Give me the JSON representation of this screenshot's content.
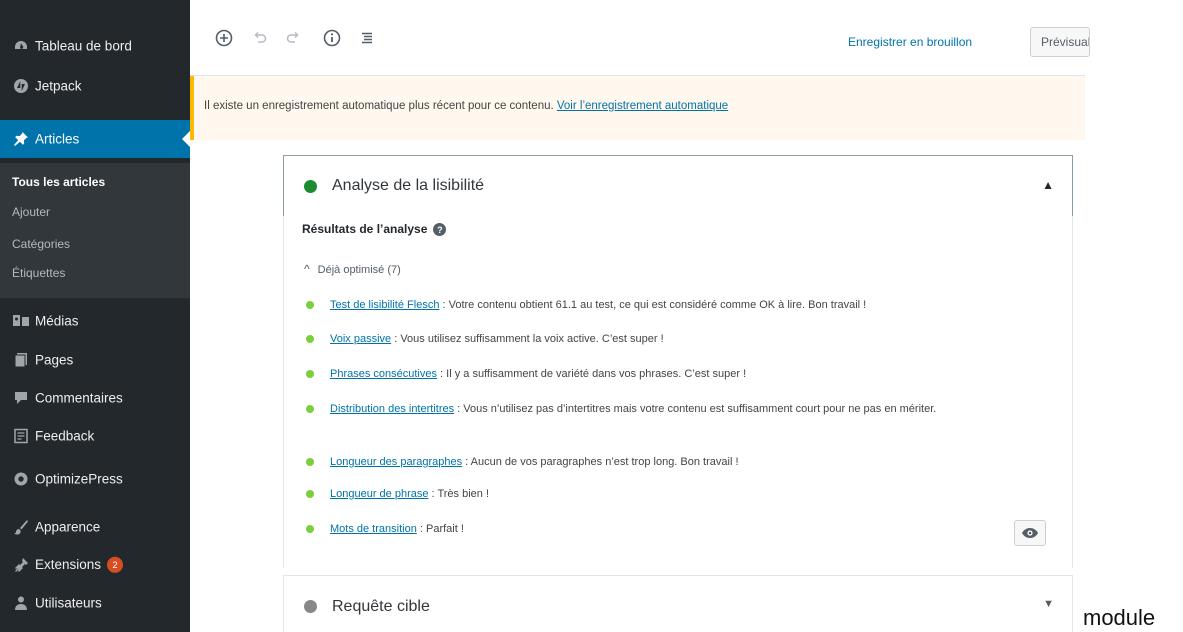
{
  "sidebar": {
    "items": [
      {
        "label": "Tableau de bord",
        "icon": "dashboard-icon"
      },
      {
        "label": "Jetpack",
        "icon": "jetpack-icon"
      },
      {
        "label": "Articles",
        "icon": "pin-icon",
        "current": true
      },
      {
        "label": "Médias",
        "icon": "media-icon"
      },
      {
        "label": "Pages",
        "icon": "pages-icon"
      },
      {
        "label": "Commentaires",
        "icon": "comments-icon"
      },
      {
        "label": "Feedback",
        "icon": "feedback-icon"
      },
      {
        "label": "OptimizePress",
        "icon": "optimizepress-icon"
      },
      {
        "label": "Apparence",
        "icon": "brush-icon"
      },
      {
        "label": "Extensions",
        "icon": "plugin-icon",
        "badge": "2"
      },
      {
        "label": "Utilisateurs",
        "icon": "users-icon"
      }
    ],
    "submenu": [
      "Tous les articles",
      "Ajouter",
      "Catégories",
      "Étiquettes"
    ]
  },
  "toolbar": {
    "icons": [
      "add-block-icon",
      "undo-icon",
      "redo-icon",
      "info-icon",
      "outline-icon"
    ],
    "save_draft": "Enregistrer en brouillon",
    "preview": "Prévisualiser"
  },
  "notice": {
    "text": "Il existe un enregistrement automatique plus récent pour ce contenu. ",
    "link": "Voir l’enregistrement automatique"
  },
  "readability": {
    "title": "Analyse de la lisibilité",
    "results_heading": "Résultats de l’analyse",
    "good_toggle": "Déjà optimisé (7)",
    "results": [
      {
        "link": "Test de lisibilité Flesch",
        "text": " : Votre contenu obtient 61.1 au test, ce qui est considéré comme OK à lire. Bon travail !"
      },
      {
        "link": "Voix passive",
        "text": " : Vous utilisez suffisamment la voix active. C’est super !"
      },
      {
        "link": "Phrases consécutives",
        "text": " : Il y a suffisamment de variété dans vos phrases. C’est super !"
      },
      {
        "link": "Distribution des intertitres",
        "text": " : Vous n’utilisez pas d’intertitres mais votre contenu est suffisamment court pour ne pas en mériter."
      },
      {
        "link": "Longueur des paragraphes",
        "text": " : Aucun de vos paragraphes n’est trop long. Bon travail !"
      },
      {
        "link": "Longueur de phrase",
        "text": " : Très bien !"
      },
      {
        "link": "Mots de transition",
        "text": " : Parfait !"
      }
    ]
  },
  "keyphrase": {
    "title": "Requête cible"
  },
  "caption": "module",
  "colors": {
    "good": "#7ad03a",
    "score_good": "#1e8c2e",
    "neutral": "#888888",
    "accent": "#0073aa",
    "sidebar_bg": "#23282d",
    "notice_border": "#ffb900"
  }
}
